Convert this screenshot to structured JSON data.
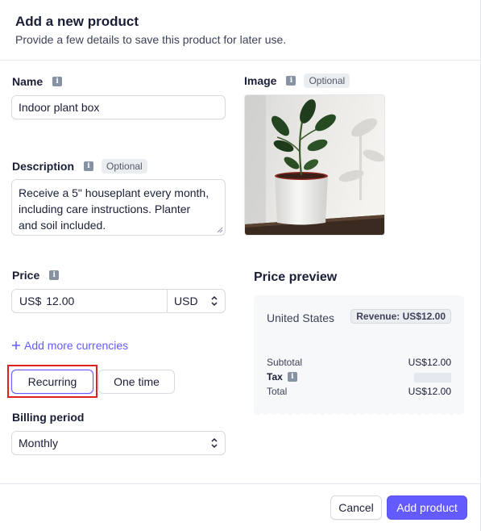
{
  "header": {
    "title": "Add a new product",
    "subtitle": "Provide a few details to save this product for later use."
  },
  "form": {
    "name": {
      "label": "Name",
      "value": "Indoor plant box"
    },
    "description": {
      "label": "Description",
      "optional": "Optional",
      "lines": [
        "Receive a 5\" houseplant every month,",
        "including care instructions. Planter",
        "and soil included."
      ]
    },
    "image": {
      "label": "Image",
      "optional": "Optional",
      "alt": "Potted plant in white planter"
    },
    "price": {
      "label": "Price",
      "prefix": "US$",
      "value": "12.00",
      "currency": "USD"
    },
    "add_currencies": "Add more currencies",
    "pricing_type": {
      "recurring": "Recurring",
      "one_time": "One time",
      "selected": "Recurring"
    },
    "billing_period": {
      "label": "Billing period",
      "value": "Monthly"
    }
  },
  "preview": {
    "title": "Price preview",
    "region": "United States",
    "revenue_badge": "Revenue: US$12.00",
    "subtotal_label": "Subtotal",
    "subtotal_value": "US$12.00",
    "tax_label": "Tax",
    "total_label": "Total",
    "total_value": "US$12.00"
  },
  "footer": {
    "cancel": "Cancel",
    "add": "Add product"
  },
  "colors": {
    "accent": "#635bff",
    "highlight": "#e0201f"
  },
  "icons": [
    "info-icon",
    "chevron-updown-icon",
    "plus-icon"
  ]
}
